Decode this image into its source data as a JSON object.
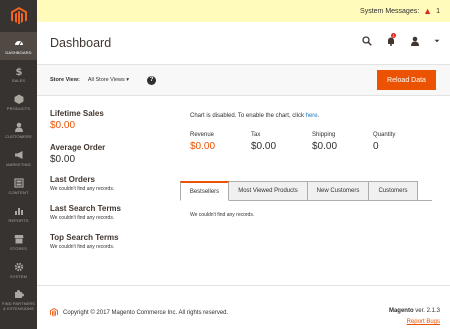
{
  "sidebar": {
    "items": [
      {
        "label": "DASHBOARD",
        "icon": "dashboard-icon"
      },
      {
        "label": "SALES",
        "icon": "dollar-icon"
      },
      {
        "label": "PRODUCTS",
        "icon": "cube-icon"
      },
      {
        "label": "CUSTOMERS",
        "icon": "person-icon"
      },
      {
        "label": "MARKETING",
        "icon": "megaphone-icon"
      },
      {
        "label": "CONTENT",
        "icon": "layout-icon"
      },
      {
        "label": "REPORTS",
        "icon": "bar-chart-icon"
      },
      {
        "label": "STORES",
        "icon": "store-icon"
      },
      {
        "label": "SYSTEM",
        "icon": "gear-icon"
      },
      {
        "label": "FIND PARTNERS & EXTENSIONS",
        "icon": "puzzle-icon"
      }
    ]
  },
  "system_messages": {
    "label": "System Messages:",
    "count": "1"
  },
  "header": {
    "title": "Dashboard",
    "notifications_count": "1"
  },
  "store_view": {
    "label": "Store View:",
    "selected": "All Store Views",
    "reload_label": "Reload Data"
  },
  "stats": {
    "lifetime_sales": {
      "title": "Lifetime Sales",
      "value": "$0.00"
    },
    "average_order": {
      "title": "Average Order",
      "value": "$0.00"
    },
    "last_orders": {
      "title": "Last Orders",
      "note": "We couldn't find any records."
    },
    "last_search_terms": {
      "title": "Last Search Terms",
      "note": "We couldn't find any records."
    },
    "top_search_terms": {
      "title": "Top Search Terms",
      "note": "We couldn't find any records."
    }
  },
  "chart": {
    "message": "Chart is disabled. To enable the chart, click ",
    "link": "here",
    "suffix": "."
  },
  "totals": [
    {
      "label": "Revenue",
      "value": "$0.00"
    },
    {
      "label": "Tax",
      "value": "$0.00"
    },
    {
      "label": "Shipping",
      "value": "$0.00"
    },
    {
      "label": "Quantity",
      "value": "0"
    }
  ],
  "tabs": [
    {
      "label": "Bestsellers",
      "active": true
    },
    {
      "label": "Most Viewed Products",
      "active": false
    },
    {
      "label": "New Customers",
      "active": false
    },
    {
      "label": "Customers",
      "active": false
    }
  ],
  "tab_content": "We couldn't find any records.",
  "footer": {
    "copyright": "Copyright © 2017 Magento Commerce Inc. All rights reserved.",
    "brand": "Magento",
    "version": " ver. 2.1.3",
    "report_bugs": "Report Bugs"
  },
  "colors": {
    "accent": "#eb5202",
    "sidebar": "#373330",
    "link": "#1979c3"
  }
}
